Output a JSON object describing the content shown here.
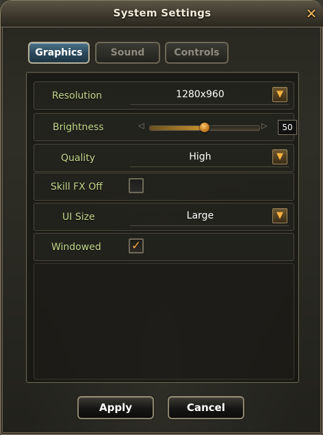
{
  "window": {
    "title": "System Settings"
  },
  "icons": {
    "close": "close-icon",
    "dropdown": "chevron-down-icon",
    "check": "checkmark-icon"
  },
  "tabs": [
    {
      "label": "Graphics",
      "active": true
    },
    {
      "label": "Sound",
      "active": false
    },
    {
      "label": "Controls",
      "active": false
    }
  ],
  "settings": {
    "resolution": {
      "label": "Resolution",
      "value": "1280x960"
    },
    "brightness": {
      "label": "Brightness",
      "value": "50",
      "level": 0.5,
      "cap_left": "◁",
      "cap_right": "▷"
    },
    "quality": {
      "label": "Quality",
      "value": "High"
    },
    "skill_fx_off": {
      "label": "Skill FX Off",
      "checked": false
    },
    "ui_size": {
      "label": "UI Size",
      "value": "Large"
    },
    "windowed": {
      "label": "Windowed",
      "checked": true,
      "mark": "✓"
    }
  },
  "buttons": {
    "apply": "Apply",
    "cancel": "Cancel"
  },
  "colors": {
    "label": "#c5d98c",
    "accent": "#ffa73a",
    "active_tab": "#2c4a5d"
  }
}
